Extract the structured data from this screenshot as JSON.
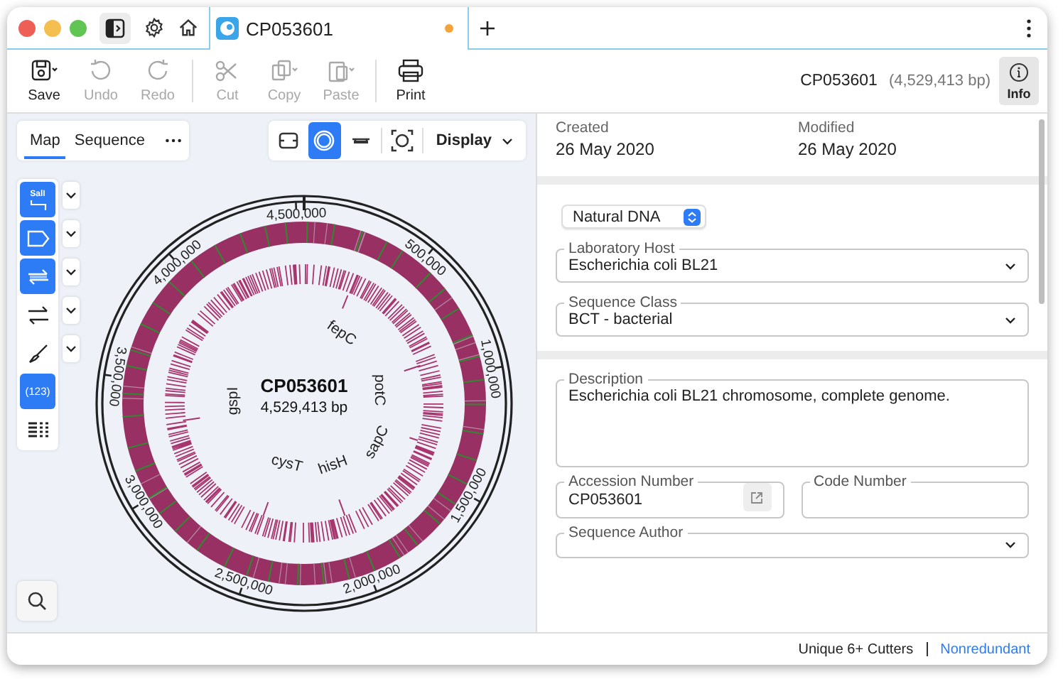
{
  "window": {
    "tab": {
      "title": "CP053601",
      "unsaved": true
    }
  },
  "toolbar": [
    {
      "kind": "save",
      "label": "Save",
      "disabled": false
    },
    {
      "kind": "undo",
      "label": "Undo",
      "disabled": true
    },
    {
      "kind": "redo",
      "label": "Redo",
      "disabled": true
    },
    {
      "kind": "cut",
      "label": "Cut",
      "disabled": true
    },
    {
      "kind": "copy",
      "label": "Copy",
      "disabled": true
    },
    {
      "kind": "paste",
      "label": "Paste",
      "disabled": true
    },
    {
      "kind": "print",
      "label": "Print",
      "disabled": false
    }
  ],
  "header": {
    "name": "CP053601",
    "length": "(4,529,413 bp)",
    "info": {
      "label": "Info",
      "selected": true
    }
  },
  "view_tabs": [
    {
      "label": "Map",
      "selected": true
    },
    {
      "label": "Sequence",
      "selected": false
    }
  ],
  "view_buttons": [
    {
      "kind": "linear",
      "selected": false
    },
    {
      "kind": "circular",
      "selected": true
    },
    {
      "kind": "ruler",
      "selected": false
    },
    {
      "kind": "fit",
      "selected": false
    }
  ],
  "display": "Display",
  "tools": [
    {
      "kind": "enzyme",
      "label": "SalI",
      "selected": true,
      "dropdown": true
    },
    {
      "kind": "feature",
      "selected": true,
      "dropdown": true
    },
    {
      "kind": "primer",
      "selected": true,
      "dropdown": true
    },
    {
      "kind": "orf",
      "selected": false,
      "dropdown": true
    },
    {
      "kind": "brush",
      "selected": false,
      "dropdown": true
    },
    {
      "kind": "numbers",
      "label": "(123)",
      "selected": true,
      "dropdown": false
    },
    {
      "kind": "grid",
      "selected": false,
      "dropdown": false
    }
  ],
  "map": {
    "name": "CP053601",
    "length": "4,529,413 bp",
    "ticks": [
      "500,000",
      "1,000,000",
      "1,500,000",
      "2,000,000",
      "2,500,000",
      "3,000,000",
      "3,500,000",
      "4,000,000",
      "4,500,000"
    ],
    "genes": [
      "fepC",
      "potC",
      "sapC",
      "hisH",
      "cysT",
      "gspI"
    ]
  },
  "info": {
    "dates": [
      {
        "label": "Created",
        "value": "26 May 2020"
      },
      {
        "label": "Modified",
        "value": "26 May 2020"
      }
    ],
    "molecule": "Natural DNA",
    "classification": [
      {
        "label": "Laboratory Host",
        "value": "Escherichia coli BL21"
      },
      {
        "label": "Sequence Class",
        "value": "BCT - bacterial"
      }
    ],
    "description": {
      "label": "Description",
      "value": "Escherichia coli BL21 chromosome, complete genome."
    },
    "accession": {
      "label": "Accession Number",
      "value": "CP053601"
    },
    "code": {
      "label": "Code Number"
    },
    "author": {
      "label": "Sequence Author"
    }
  },
  "status": {
    "enzymes": "Unique 6+ Cutters",
    "mode": "Nonredundant"
  }
}
